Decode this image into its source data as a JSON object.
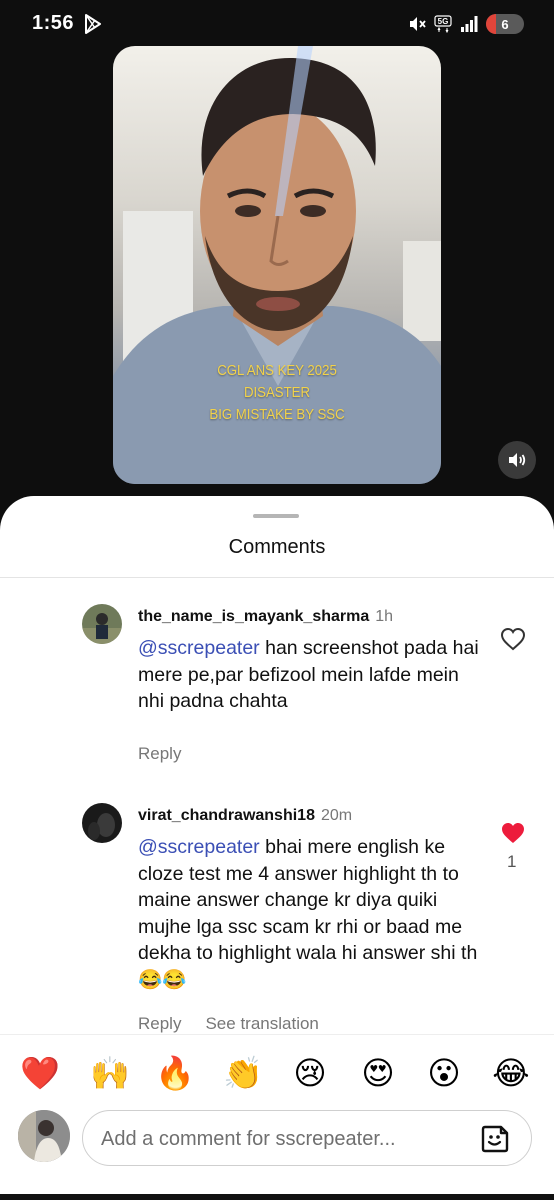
{
  "status_bar": {
    "time": "1:56",
    "network": "5G",
    "battery": "6",
    "icons": [
      "play-store-icon",
      "mute-icon",
      "5g-network-icon",
      "signal-icon",
      "battery-icon"
    ]
  },
  "video": {
    "caption_lines": [
      "CGL ANS KEY 2025",
      "DISASTER",
      "BIG MISTAKE BY SSC"
    ],
    "volume_icon": "volume-icon"
  },
  "sheet": {
    "title": "Comments"
  },
  "comments": [
    {
      "username": "the_name_is_mayank_sharma",
      "time": "1h",
      "mention": "@sscrepeater",
      "text": " han screenshot pada hai mere pe,par befizool mein lafde mein nhi padna chahta",
      "reply_label": "Reply",
      "liked": false
    },
    {
      "username": "virat_chandrawanshi18",
      "time": "20m",
      "mention": "@sscrepeater",
      "text": " bhai mere english ke cloze test me  4 answer highlight th to maine answer change kr diya quiki mujhe lga ssc scam kr rhi or baad me dekha to highlight wala hi answer shi th😂😂",
      "reply_label": "Reply",
      "translation_label": "See translation",
      "liked": true,
      "like_count": "1"
    }
  ],
  "emoji_bar": [
    "❤️",
    "🙌",
    "🔥",
    "👏",
    "😢",
    "😍",
    "😮",
    "😂"
  ],
  "input": {
    "placeholder": "Add a comment for sscrepeater...",
    "sticker_icon": "sticker-icon"
  },
  "colors": {
    "mention": "#3b4fb5",
    "like_red": "#ed1c3c",
    "caption_yellow": "#f2d24a"
  }
}
